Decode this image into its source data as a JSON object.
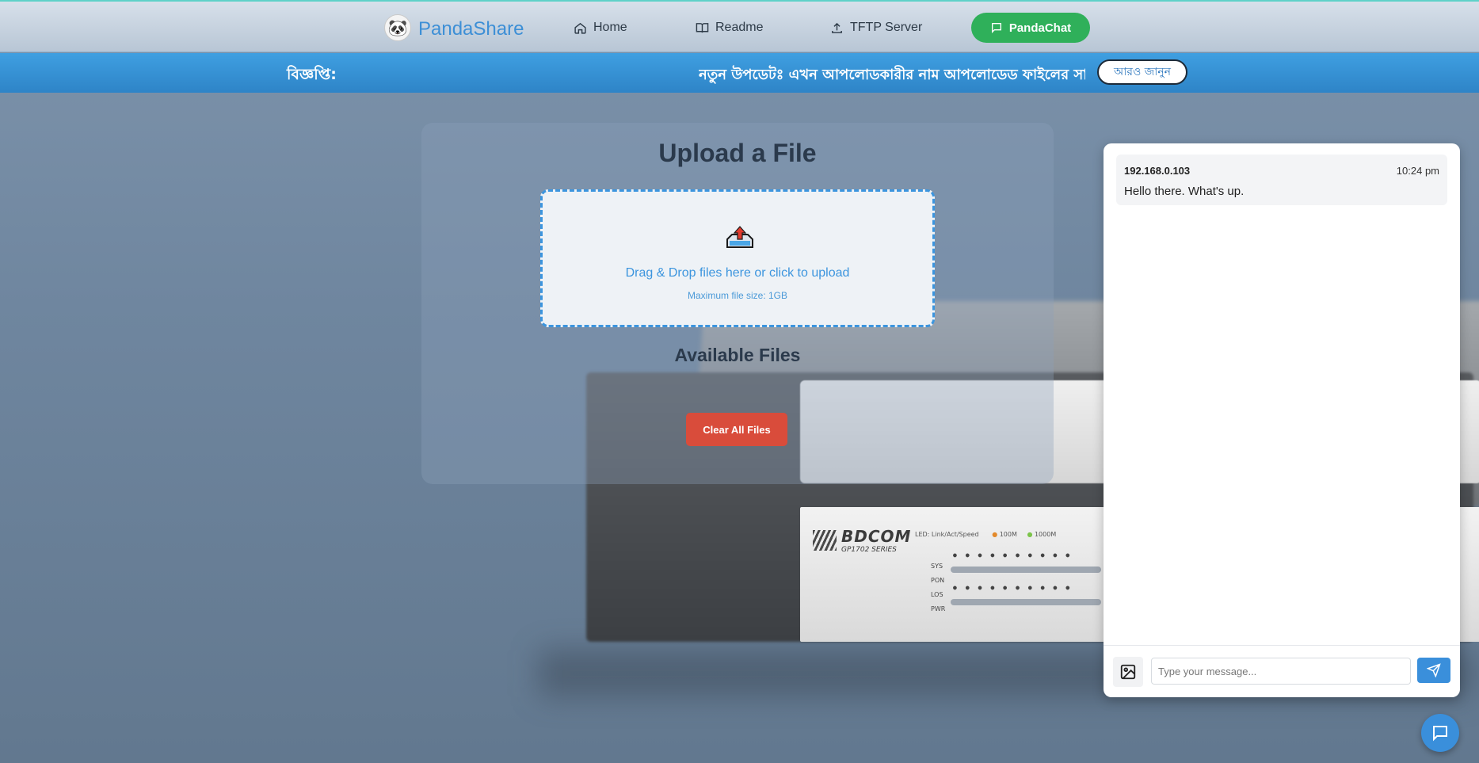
{
  "navbar": {
    "brand": "PandaShare",
    "logo_icon": "panda-icon",
    "items": [
      {
        "label": "Home",
        "icon": "home-icon"
      },
      {
        "label": "Readme",
        "icon": "book-icon"
      },
      {
        "label": "TFTP Server",
        "icon": "upload-icon"
      }
    ],
    "chat_button": {
      "label": "PandaChat",
      "icon": "message-icon"
    }
  },
  "notice": {
    "label": "বিজ্ঞপ্তি:",
    "text": "নতুন উপডেটঃ এখন আপলোডকারীর নাম আপলোডেড ফাইলের সাথে দে",
    "learn_more": "আরও জানুন"
  },
  "upload": {
    "title": "Upload a File",
    "dropzone_text": "Drag & Drop files here or click to upload",
    "max_size_text": "Maximum file size: 1GB",
    "files_title": "Available Files",
    "clear_button": "Clear All Files"
  },
  "chat": {
    "messages": [
      {
        "sender": "192.168.0.103",
        "time": "10:24 pm",
        "text": "Hello there. What's up."
      }
    ],
    "input_placeholder": "Type your message...",
    "image_button_icon": "image-icon",
    "send_button_icon": "send-icon"
  },
  "floating_button_icon": "chat-bubble-icon",
  "background": {
    "device_brand": "BDCOM",
    "device_series": "GP1702 SERIES",
    "led_label": "LED: Link/Act/Speed",
    "led_100": "100M",
    "led_1000": "1000M",
    "status_labels": [
      "SYS",
      "PON",
      "LOS",
      "PWR"
    ]
  },
  "colors": {
    "accent": "#3a8fdb",
    "chat_green": "#2fb05a",
    "danger": "#d94c3b",
    "notice_blue": "#2e84c7"
  }
}
